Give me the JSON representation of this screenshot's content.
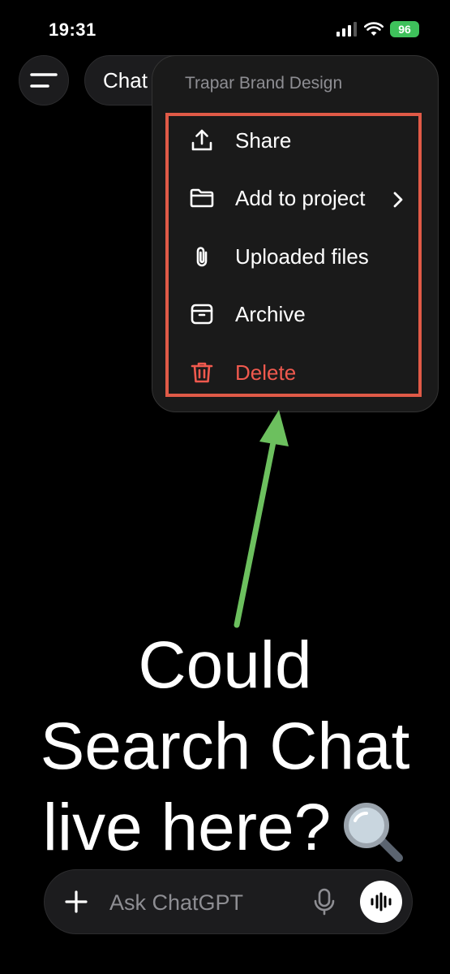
{
  "status_bar": {
    "time": "19:31",
    "battery": "96",
    "icons": [
      "cellular-signal-icon",
      "wifi-icon",
      "battery-icon"
    ]
  },
  "header": {
    "chat_title": "Chat",
    "menu_icon": "hamburger-menu-icon"
  },
  "dropdown": {
    "title": "Trapar Brand Design",
    "items": [
      {
        "label": "Share",
        "icon": "share-icon"
      },
      {
        "label": "Add to project",
        "icon": "folder-icon",
        "has_submenu": true
      },
      {
        "label": "Uploaded files",
        "icon": "paperclip-icon"
      },
      {
        "label": "Archive",
        "icon": "archive-icon"
      },
      {
        "label": "Delete",
        "icon": "trash-icon",
        "color": "#f0594e"
      }
    ],
    "highlight_color": "#e05a47"
  },
  "annotation": {
    "arrow_color": "#6cc05e",
    "lines": [
      "Could",
      "Search Chat",
      "live here?"
    ],
    "emoji_icon": "magnifying-glass-icon"
  },
  "composer": {
    "placeholder": "Ask ChatGPT",
    "icons": [
      "plus-icon",
      "microphone-icon",
      "voice-waveform-icon"
    ]
  }
}
